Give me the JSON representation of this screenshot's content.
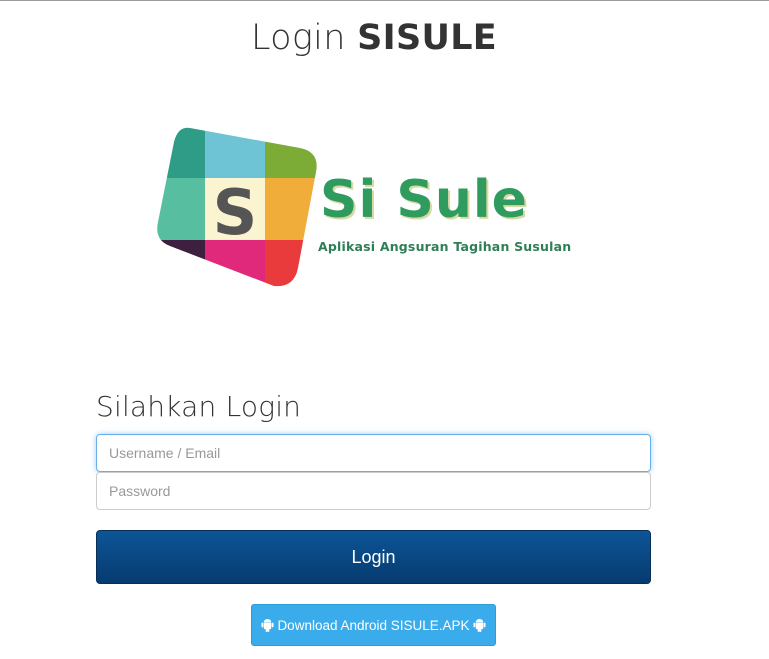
{
  "page": {
    "title_light": "Login",
    "title_bold": "SISULE"
  },
  "logo": {
    "letter": "S",
    "name": "Si Sule",
    "tagline": "Aplikasi Angsuran Tagihan Susulan"
  },
  "form": {
    "heading": "Silahkan Login",
    "username_placeholder": "Username / Email",
    "password_placeholder": "Password",
    "submit_label": "Login"
  },
  "download": {
    "label": "Download Android SISULE.APK",
    "icon": "android-icon"
  },
  "colors": {
    "login_button": "#0a4a86",
    "download_button": "#3aacec",
    "logo_green": "#2f9b5e"
  }
}
